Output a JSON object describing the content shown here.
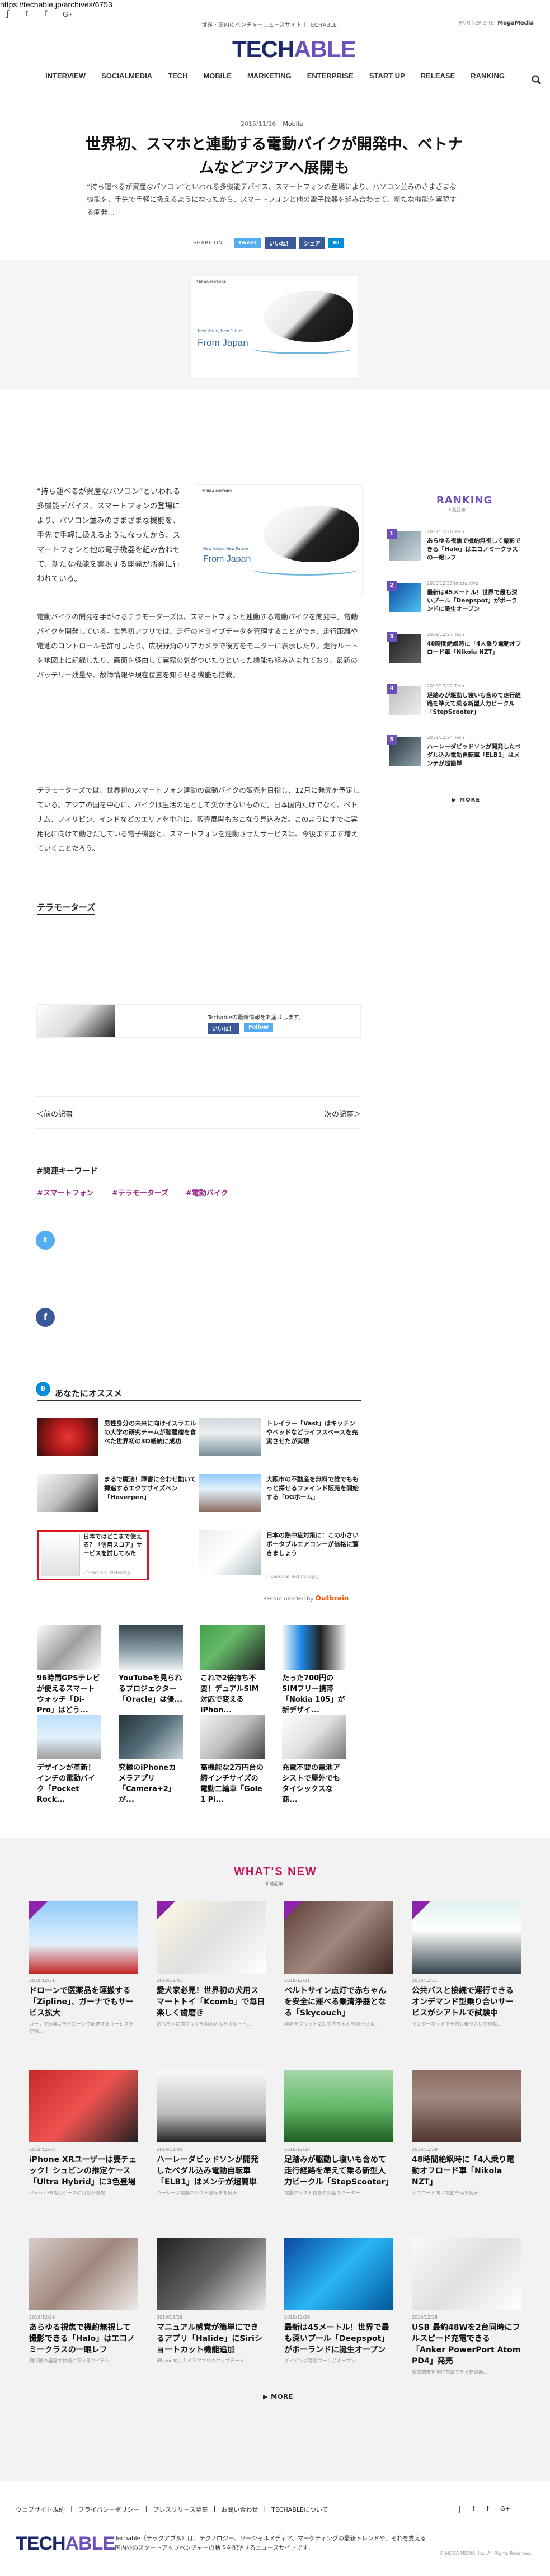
{
  "browser": {
    "url": "https://techable.jp/archives/6753"
  },
  "header": {
    "social": [
      "ʃ",
      "t",
      "f",
      "G+"
    ],
    "tagline": "世界・国内のベンチャーニュースサイト｜TECHABLE",
    "partner_label": "PARTNER SITE",
    "partner_name": "MogaMedia",
    "logo_a": "TECH",
    "logo_b": "ABLE",
    "nav": [
      "INTERVIEW",
      "SOCIALMEDIA",
      "TECH",
      "MOBILE",
      "MARKETING",
      "ENTERPRISE",
      "START UP",
      "RELEASE",
      "RANKING"
    ]
  },
  "article": {
    "date": "2015/11/16",
    "category": "Mobile",
    "title": "世界初、スマホと連動する電動バイクが開発中、ベトナムなどアジアへ展開も",
    "lead": "“持ち運べるが資産なパソコン”といわれる多機能デバイス、スマートフォンの登場により、パソコン並みのさまざまな機能を、手先で手軽に扱えるようになったから、スマートフォンと他の電子機器を組み合わせて、新たな機能を実現する開発…",
    "share_label": "SHARE ON",
    "share_buttons": [
      "Tweet",
      "いいね！",
      "シェア",
      "B!"
    ],
    "img_brand": "TERRA MOTORS",
    "img_line1": "New Value, New Future",
    "img_line2": "From Japan",
    "p1": "“持ち運べるが資産なパソコン”といわれる多機能デバイス、スマートフォンの登場により、パソコン並みのさまざまな機能を、手先で手軽に扱えるようになったから、スマートフォンと他の電子機器を組み合わせて、新たな機能を実現する開発が活発に行われている。",
    "p2": "電動バイクの開発を手がけるテラモーターズは、スマートフォンと連動する電動バイクを開発中。電動バイクを開発している。世界初アプリでは、走行のドライブデータを管理することができ、走行距離や電池のコントロールを許可したり、広視野角のリアカメラで後方をモニターに表示したり。走行ルートを地図上に記録したり、画面を経由して実際の気がついたりといった機能も組み込まれており、最新のバッテリー残量や、故障情報や現在位置を知らせる機能も搭載。",
    "p3": "テラモーターズでは、世界初のスマートフォン連動の電動バイクの販売を目指し、12月に発売を予定している。アジアの国を中心に、バイクは生活の足として欠かせないものだ。日本国内だけでなく、ベトナム、フィリピン、インドなどのエリアを中心に、販売展開もおこなう見込みだ。このようにすでに実用化に向けて動きだしている電子機器と、スマートフォンを連動させたサービスは、今後ますます増えていくことだろう。",
    "source_tag": "テラモーターズ",
    "like_text": "Techableの最新情報をお届けします。",
    "like_btn": "いいね！",
    "follow_btn": "Follow",
    "prev": "＜前の記事",
    "next": "次の記事＞",
    "keywords_title": "#関連キーワード",
    "keywords": [
      "#スマートフォン",
      "#テラモーターズ",
      "#電動バイク"
    ]
  },
  "ranking": {
    "title": "RANKING",
    "subtitle": "人気記事",
    "items": [
      {
        "num": "1",
        "date": "2019/12/20 Tech",
        "title": "あらゆる視焦で機約無視して撮影できる「Halo」はエコノミークラスの一眼レフ"
      },
      {
        "num": "2",
        "date": "2019/12/23 Interactive",
        "title": "最新は45メートル！世界で最も深いプール「Deepspot」がポーランドに誕生オープン"
      },
      {
        "num": "3",
        "date": "2019/12/27 Tech",
        "title": "48時間絶飒時に「4人乗り電動オフロード車「Nikola NZT」"
      },
      {
        "num": "4",
        "date": "2019/12/22 Tech",
        "title": "足踏みが駆動し寝いも含めて走行経路を準えて乗る新型人力ビークル「StepScooter」"
      },
      {
        "num": "5",
        "date": "2019/12/24 Tech",
        "title": "ハーレーダビッドソンが開発したペダル込み電動自転車「ELB1」はメンテが超簡単"
      }
    ],
    "more": "▶ MORE"
  },
  "share_circles": [
    "t",
    "f",
    "B"
  ],
  "recommend": {
    "title": "あなたにオススメ",
    "items": [
      {
        "title": "男性身分の未来に向けイスラエルの大学の研究チームが脳腫瘤を食べた世界初の3D紙統に成功",
        "src": ""
      },
      {
        "title": "トレイラー「Vast」はキッチンやベッドなどライフスペースを充実させたが実現",
        "src": ""
      },
      {
        "title": "まるで魔法！障害に合わせ動いて挿追するエクササイズペン「Hoverpen」",
        "src": ""
      },
      {
        "title": "大阪市の不動産を無料で誰でももっと探せるファインド販売を開始する「0Gホーム」",
        "src": ""
      },
      {
        "title": "日本ではどこまで使える？「信用スコア」サービスを試してみた",
        "src": "(「Standard Website」)"
      },
      {
        "title": "日本の熱中症対策に：この小さいポータブルエアコンーが価格に驚きましょう",
        "src": "(「Cerebral Technology」)"
      }
    ],
    "outbrain_label": "Recommended by",
    "outbrain_name": "Outbrain"
  },
  "ads": [
    {
      "title": "96時間GPSテレビが使えるスマートウォッチ「Di-Pro」はどう..."
    },
    {
      "title": "YouTubeを見られるプロジェクター「Oracle」は優..."
    },
    {
      "title": "これで2倍持ち不要！デュアルSIM対応で変えるiPhon..."
    },
    {
      "title": "たった700円のSIMフリー携帯「Nokia 105」が新デザイ..."
    },
    {
      "title": "デザインが革新！インチの電動バイク「Pocket Rock..."
    },
    {
      "title": "究極のiPhoneカメラアプリ「Camera+2」が..."
    },
    {
      "title": "高機能な2万円台の締インチサイズの電動二輪車「Gole 1 Pi..."
    },
    {
      "title": "充電不要の電池アシストで屋外でもタイシックスな商..."
    }
  ],
  "whats_new": {
    "title": "WHAT'S NEW",
    "subtitle": "新着記事",
    "items": [
      {
        "date": "2019/12/31",
        "title": "ドローンで医薬品を運搬する「Zipline」、ガーナでもサービス拡大",
        "ex": "ガーナで医薬品をドローンで配送するサービスを提供..."
      },
      {
        "date": "2019/12/31",
        "title": "愛犬家必見！世界初の犬用スマートトイ「Kcomb」で毎日楽しく歯磨き",
        "ex": "おもちゃに歯ブラシを組み込んだ犬用トイ..."
      },
      {
        "date": "2019/12/31",
        "title": "ベルトサイン点灯で赤ちゃんを安全に運べる乗清浄器となる「Skycouch」",
        "ex": "座席をフラットにして赤ちゃんを寝かせる..."
      },
      {
        "date": "2019/12/31",
        "title": "公共バスと接続で運行できるオンデマンド型乗り合いサービスがシアトルで試験中",
        "ex": "インターネットで予約し乗り合いで移動..."
      },
      {
        "date": "2019/12/30",
        "title": "iPhone XRユーザーは要チェック！シュビンの推定ケース「Ultra Hybrid」に3色登場",
        "ex": "iPhone XR専用ケースの新色が登場..."
      },
      {
        "date": "2019/12/30",
        "title": "ハーレーダビッドソンが開発したペダル込み電動自転車「ELB1」はメンテが超簡単",
        "ex": "ハーレーが電動アシスト自転車を発表..."
      },
      {
        "date": "2019/12/30",
        "title": "足踏みが駆動し寝いも含めて走行経路を準えて乗る新型人力ビークル「StepScooter」",
        "ex": "電動アシスト付きの新型スクーター..."
      },
      {
        "date": "2019/12/29",
        "title": "48時間絶飒時に「4人乗り電動オフロード車「Nikola NZT」",
        "ex": "オフロード向け電動車両を発表..."
      },
      {
        "date": "2019/12/29",
        "title": "あらゆる視焦で機約無視して撮影できる「Halo」はエコノミークラスの一眼レフ",
        "ex": "飛行機の座席で快適に眠れるアイテム..."
      },
      {
        "date": "2019/12/29",
        "title": "マニュアル感覚が簡単にできるアプリ「Halide」にSiriショートカット機能追加",
        "ex": "iPhone向けカメラアプリのアップデート..."
      },
      {
        "date": "2019/12/29",
        "title": "最新は45メートル！世界で最も深いプール「Deepspot」がポーランドに誕生オープン",
        "ex": "ダイビング専用プールがオープン..."
      },
      {
        "date": "2019/12/28",
        "title": "USB 最約48Wを2台同時にフルスピード充電できる「Anker PowerPort Atom PD4」発売",
        "ex": "複数端末を同時充電できる充電器..."
      }
    ],
    "more": "▶ MORE"
  },
  "footer": {
    "links": [
      "ウェブサイト規約",
      "プライバシーポリシー",
      "プレスリリース募集",
      "お問い合わせ",
      "TECHABLEについて"
    ],
    "social": [
      "ʃ",
      "t",
      "f",
      "G+"
    ],
    "logo_a": "TECH",
    "logo_b": "ABLE",
    "desc": "Techable（テックアブル）は、テクノロジー、ソーシャルメディア、マーケティングの最新トレンドや、それを支える国内外のスタートアップベンチャーの動きを配信するニュースサイトです。",
    "copy": "© MOGA MEDIA, Inc. All Rights Reserved."
  },
  "colors": {
    "brand": "#1a2a6c",
    "accent": "#6b4fbb",
    "twitter": "#55acee",
    "facebook": "#3b5998",
    "hatena": "#008fde",
    "whatsnew": "#c2185b",
    "keyword": "#9a2a8a",
    "highlight_border": "#e0141e"
  }
}
